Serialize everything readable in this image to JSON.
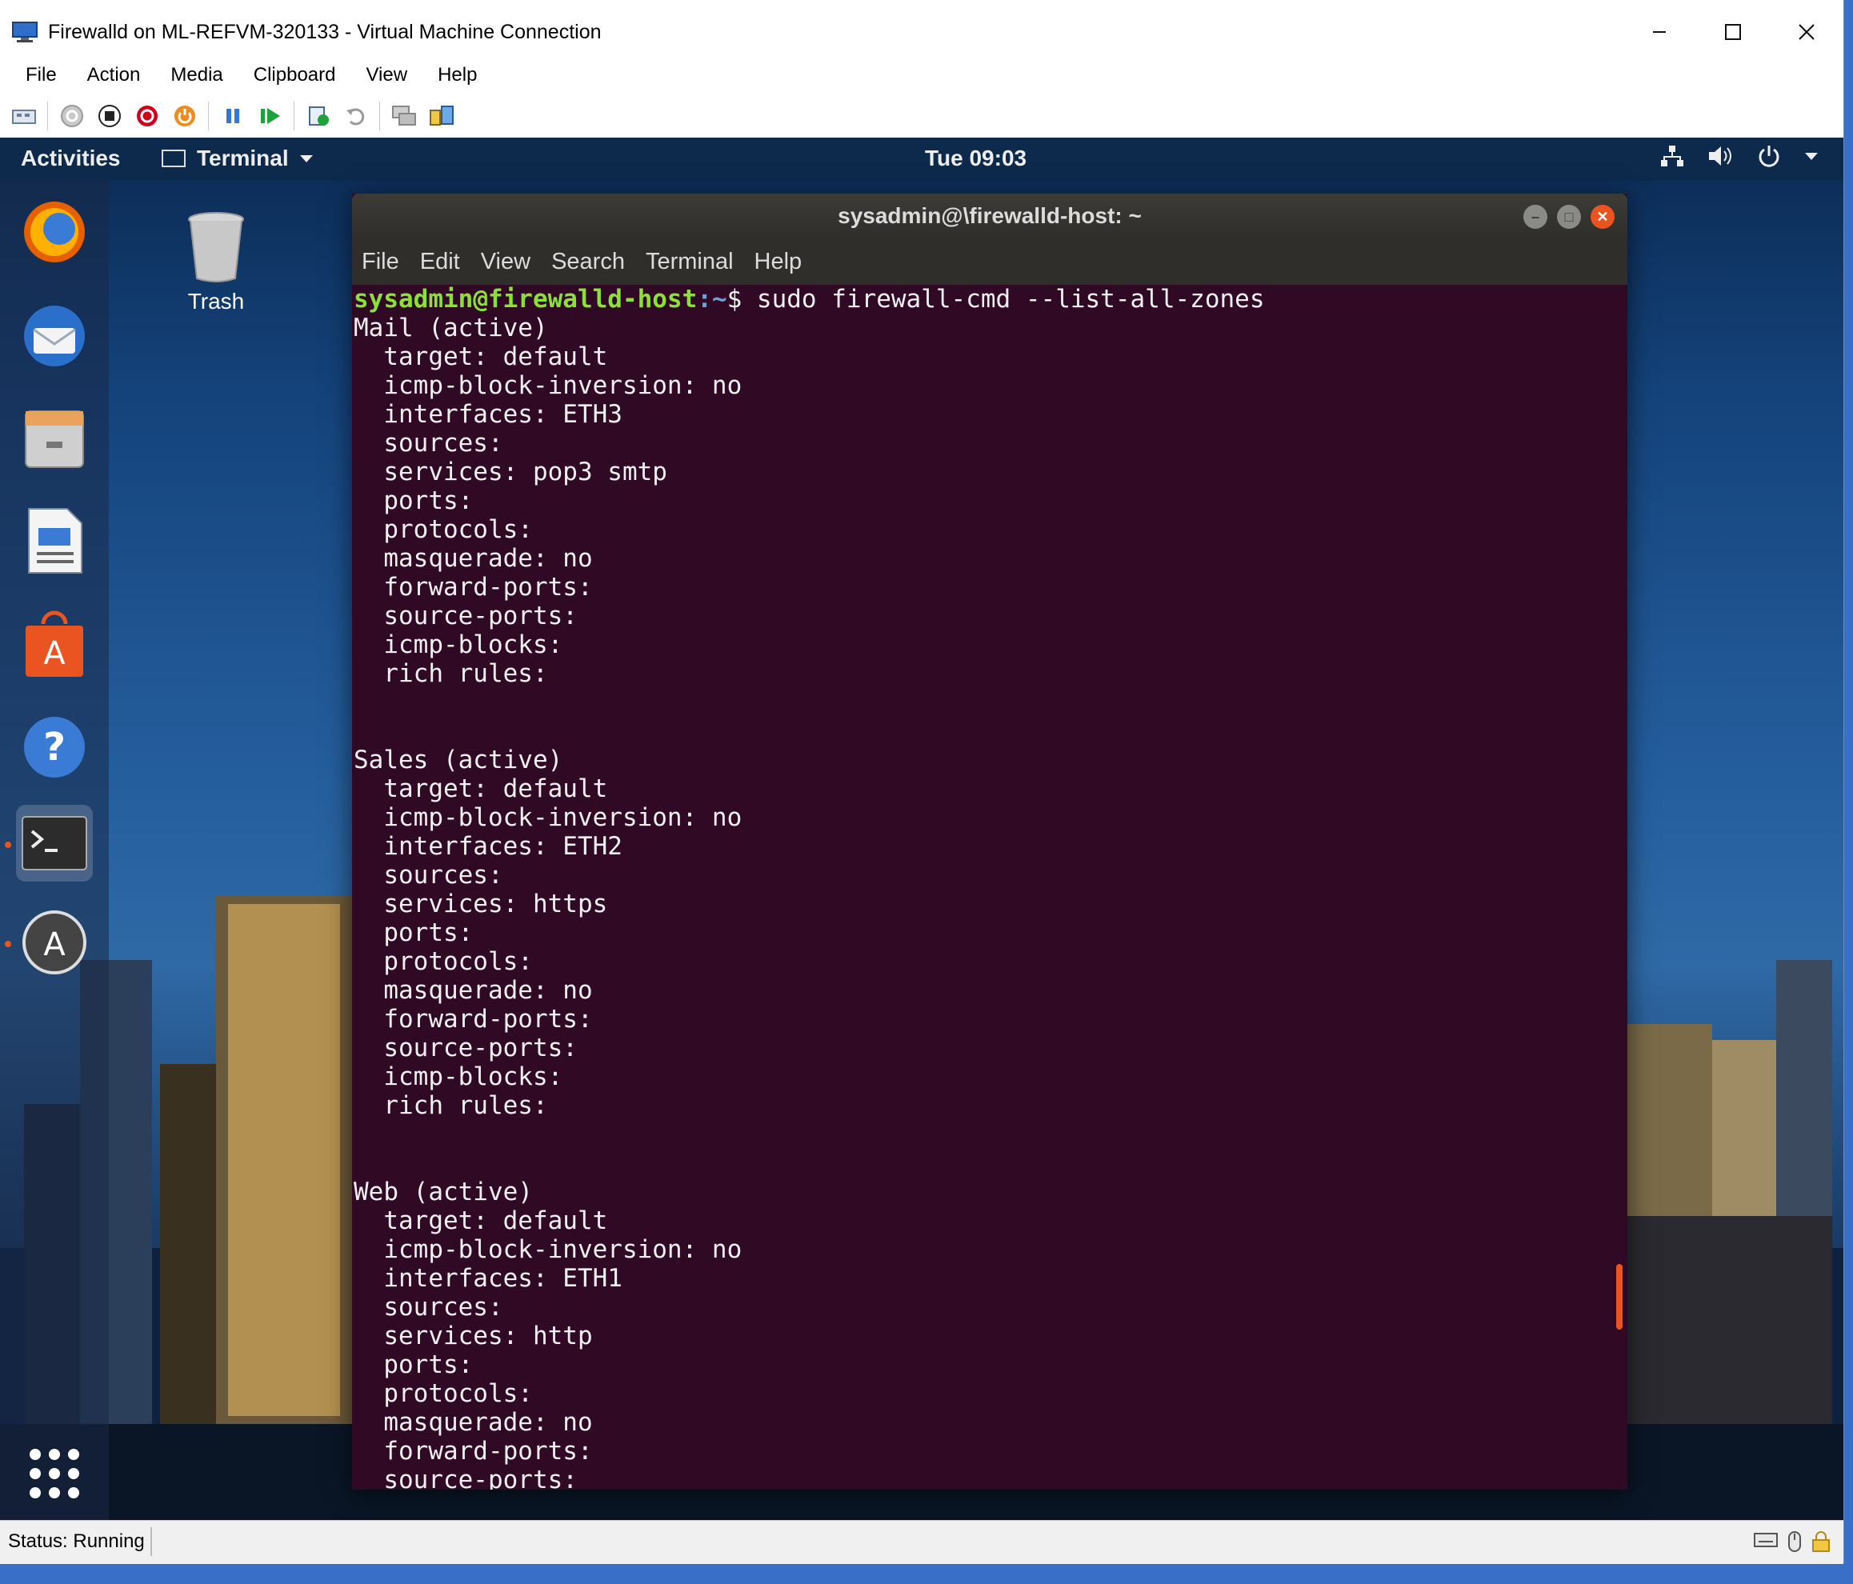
{
  "window": {
    "title": "Firewalld on ML-REFVM-320133 - Virtual Machine Connection",
    "controls": [
      "minimize",
      "maximize",
      "close"
    ]
  },
  "menu": [
    "File",
    "Action",
    "Media",
    "Clipboard",
    "View",
    "Help"
  ],
  "toolbar_icons": [
    "ctrl-alt-del-icon",
    "start-icon",
    "turn-off-icon",
    "shutdown-icon",
    "save-icon",
    "pause-icon",
    "resume-icon",
    "checkpoint-icon",
    "revert-icon",
    "enhanced-session-icon",
    "share-icon"
  ],
  "gnome": {
    "activities": "Activities",
    "app_menu": "Terminal",
    "clock": "Tue 09:03"
  },
  "desktop": {
    "trash_label": "Trash"
  },
  "dock_icons": [
    "firefox-icon",
    "thunderbird-icon",
    "files-icon",
    "libreoffice-writer-icon",
    "software-center-icon",
    "help-icon",
    "terminal-icon",
    "software-updater-icon",
    "show-apps-icon"
  ],
  "terminal": {
    "title": "sysadmin@\\firewalld-host: ~",
    "menu": [
      "File",
      "Edit",
      "View",
      "Search",
      "Terminal",
      "Help"
    ],
    "prompt_user": "sysadmin@firewalld-host",
    "prompt_path": ":~",
    "prompt_sign": "$ ",
    "command": "sudo firewall-cmd --list-all-zones",
    "output": "Mail (active)\n  target: default\n  icmp-block-inversion: no\n  interfaces: ETH3\n  sources: \n  services: pop3 smtp\n  ports: \n  protocols: \n  masquerade: no\n  forward-ports: \n  source-ports: \n  icmp-blocks: \n  rich rules: \n\n\nSales (active)\n  target: default\n  icmp-block-inversion: no\n  interfaces: ETH2\n  sources: \n  services: https\n  ports: \n  protocols: \n  masquerade: no\n  forward-ports: \n  source-ports: \n  icmp-blocks: \n  rich rules: \n\n\nWeb (active)\n  target: default\n  icmp-block-inversion: no\n  interfaces: ETH1\n  sources: \n  services: http\n  ports: \n  protocols: \n  masquerade: no\n  forward-ports: \n  source-ports: "
  },
  "status": {
    "text": "Status: Running"
  }
}
